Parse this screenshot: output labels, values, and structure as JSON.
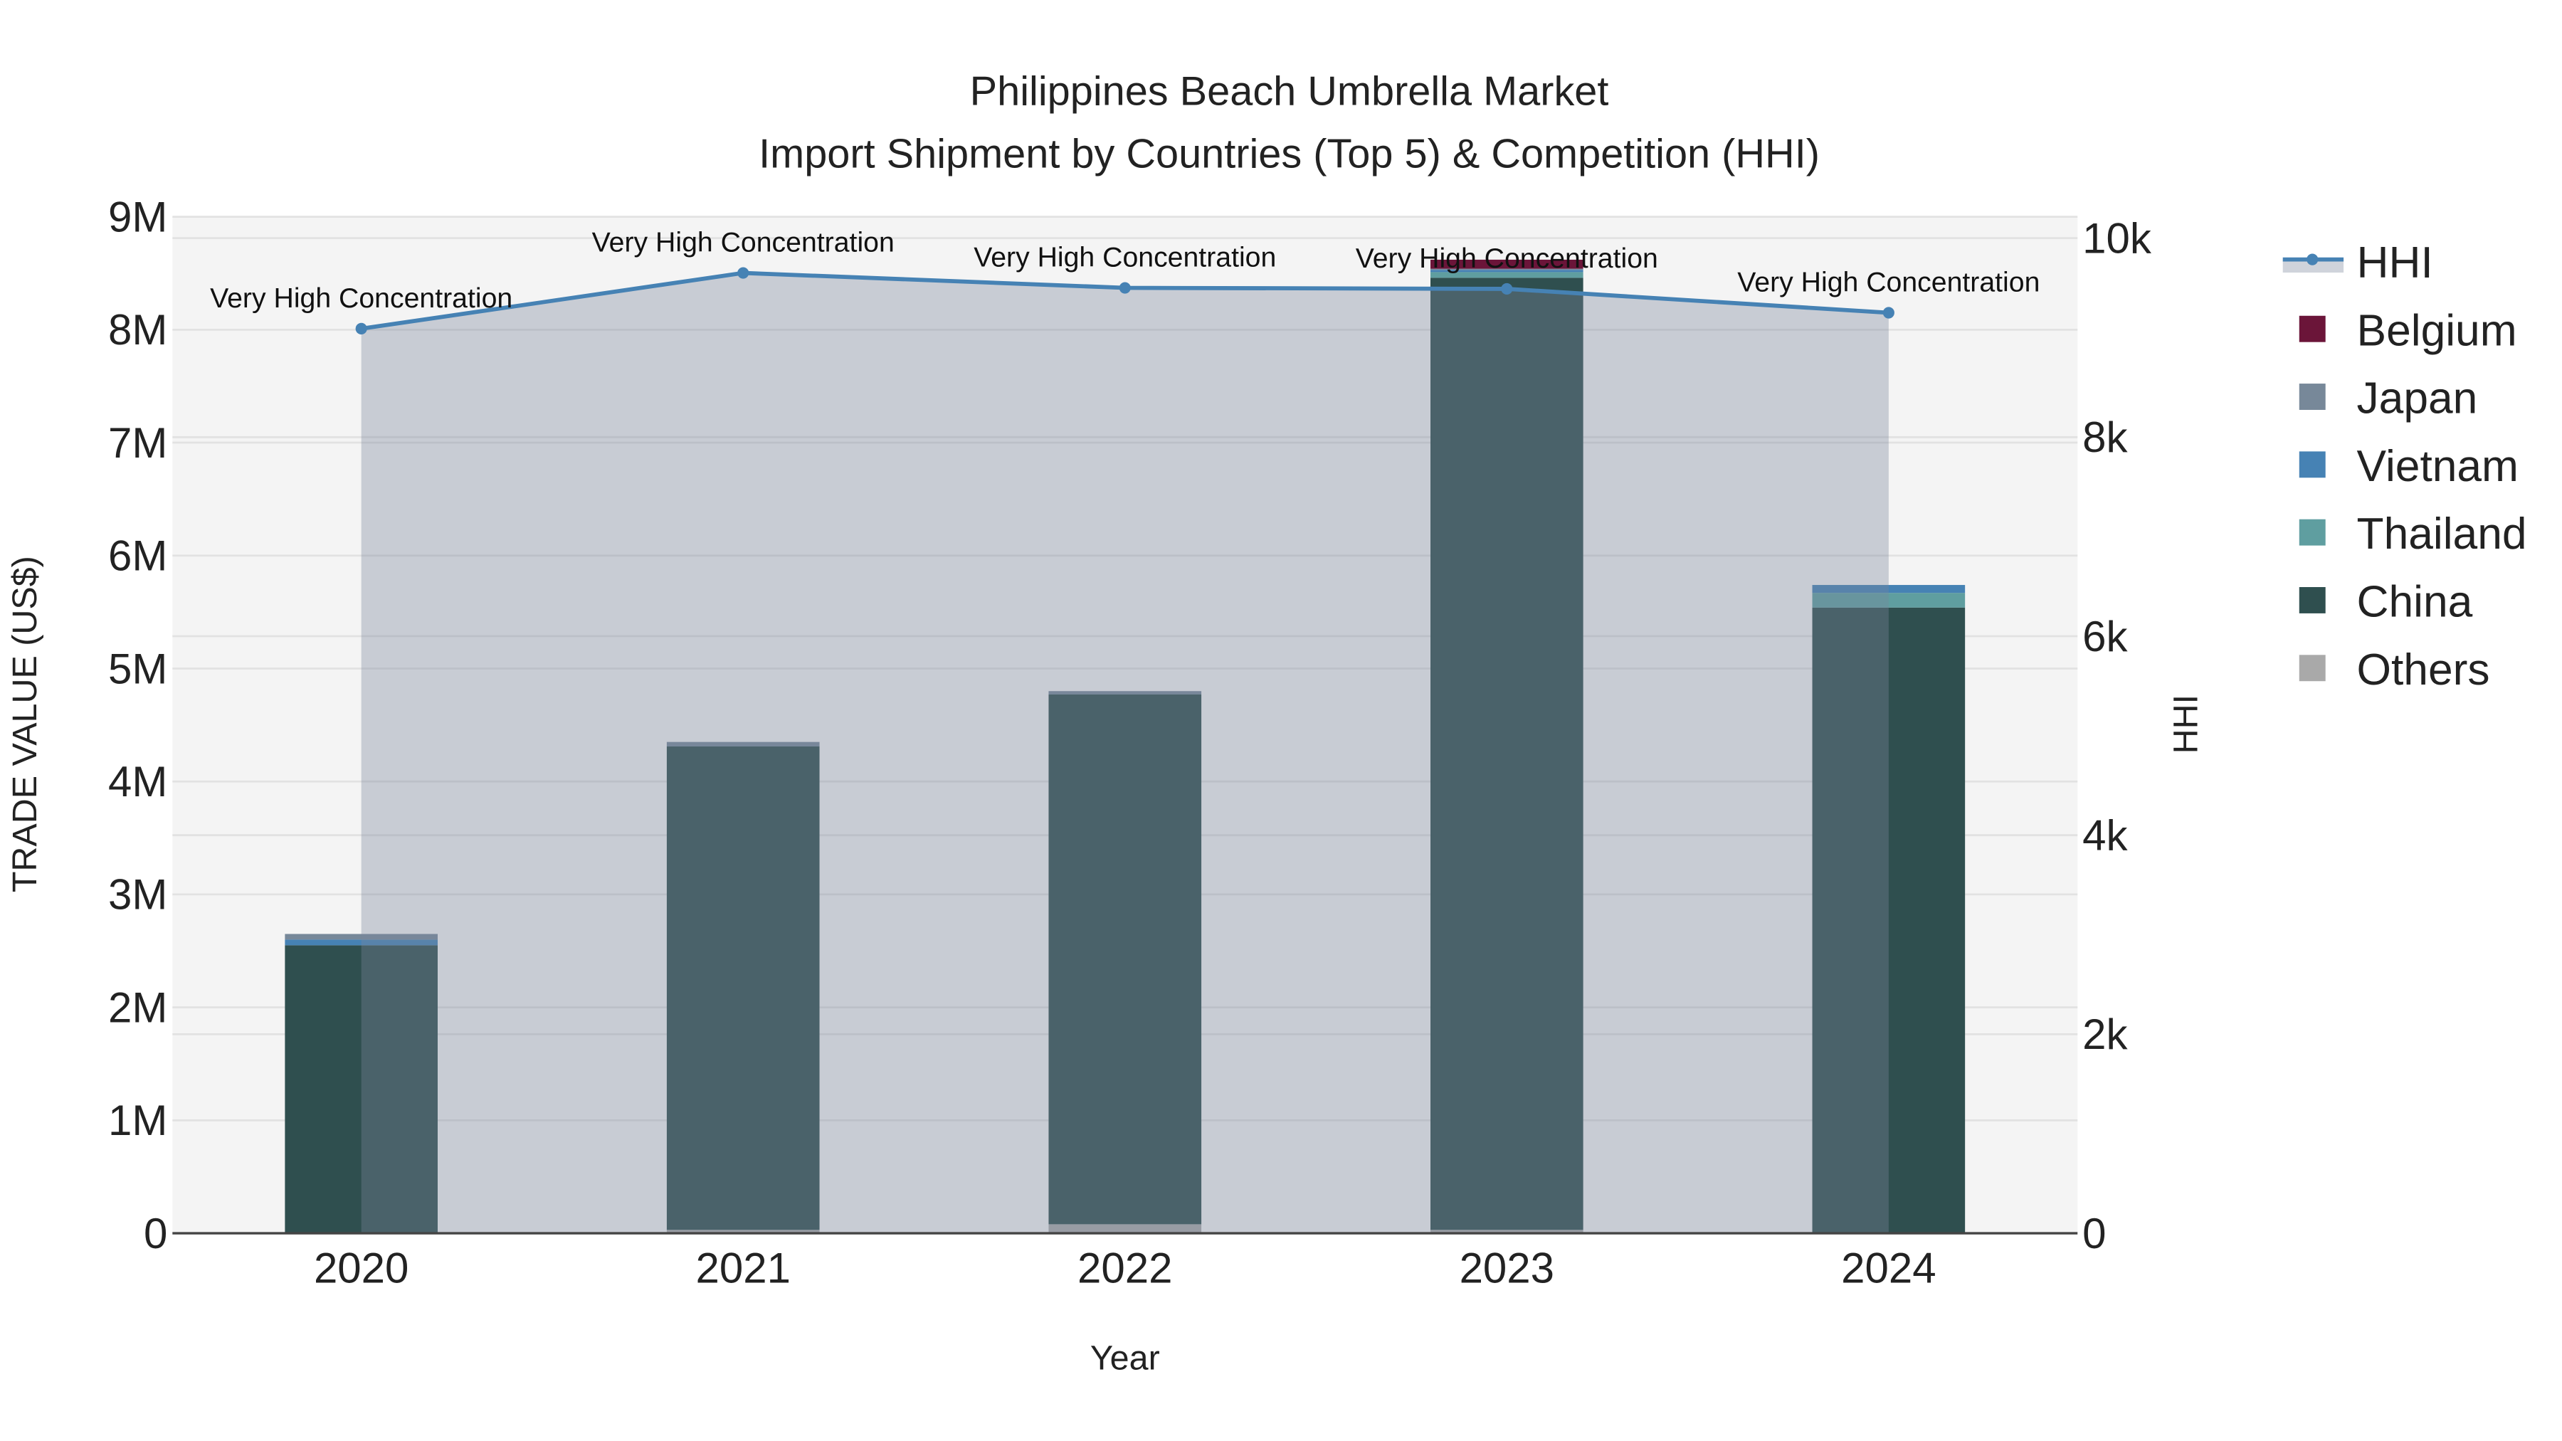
{
  "chart_data": {
    "type": "bar",
    "stacked": true,
    "title_line1": "Philippines Beach Umbrella Market",
    "title_line2": "Import Shipment by Countries (Top 5) & Competition (HHI)",
    "xlabel": "Year",
    "ylabel": "TRADE VALUE (US$)",
    "y2label": "HHI",
    "categories": [
      "2020",
      "2021",
      "2022",
      "2023",
      "2024"
    ],
    "ylim": [
      0,
      9000000
    ],
    "y2lim": [
      0,
      10200
    ],
    "y_ticks": [
      {
        "v": 0,
        "label": "0"
      },
      {
        "v": 1000000,
        "label": "1M"
      },
      {
        "v": 2000000,
        "label": "2M"
      },
      {
        "v": 3000000,
        "label": "3M"
      },
      {
        "v": 4000000,
        "label": "4M"
      },
      {
        "v": 5000000,
        "label": "5M"
      },
      {
        "v": 6000000,
        "label": "6M"
      },
      {
        "v": 7000000,
        "label": "7M"
      },
      {
        "v": 8000000,
        "label": "8M"
      },
      {
        "v": 9000000,
        "label": "9M"
      }
    ],
    "y2_ticks": [
      {
        "v": 0,
        "label": "0"
      },
      {
        "v": 2000,
        "label": "2k"
      },
      {
        "v": 4000,
        "label": "4k"
      },
      {
        "v": 6000,
        "label": "6k"
      },
      {
        "v": 8000,
        "label": "8k"
      },
      {
        "v": 10000,
        "label": "10k"
      }
    ],
    "series": [
      {
        "name": "Others",
        "color": "#A9A9A9",
        "values": [
          10000,
          30000,
          80000,
          30000,
          10000
        ]
      },
      {
        "name": "China",
        "color": "#2F4F4F",
        "values": [
          2540000,
          4280000,
          4690000,
          8430000,
          5530000
        ]
      },
      {
        "name": "Thailand",
        "color": "#5F9EA0",
        "values": [
          0,
          0,
          0,
          50000,
          130000
        ]
      },
      {
        "name": "Vietnam",
        "color": "#4682B4",
        "values": [
          50000,
          0,
          0,
          20000,
          70000
        ]
      },
      {
        "name": "Japan",
        "color": "#778899",
        "values": [
          50000,
          40000,
          30000,
          10000,
          0
        ]
      },
      {
        "name": "Belgium",
        "color": "#6B1539",
        "values": [
          0,
          0,
          0,
          80000,
          0
        ]
      }
    ],
    "hhi": {
      "name": "HHI",
      "color": "#4682B4",
      "values": [
        9090,
        9650,
        9500,
        9490,
        9250
      ],
      "annotations": [
        "Very High Concentration",
        "Very High Concentration",
        "Very High Concentration",
        "Very High Concentration",
        "Very High Concentration"
      ]
    },
    "legend": [
      "HHI",
      "Belgium",
      "Japan",
      "Vietnam",
      "Thailand",
      "China",
      "Others"
    ],
    "legend_placement": "top-right",
    "grid": true
  }
}
